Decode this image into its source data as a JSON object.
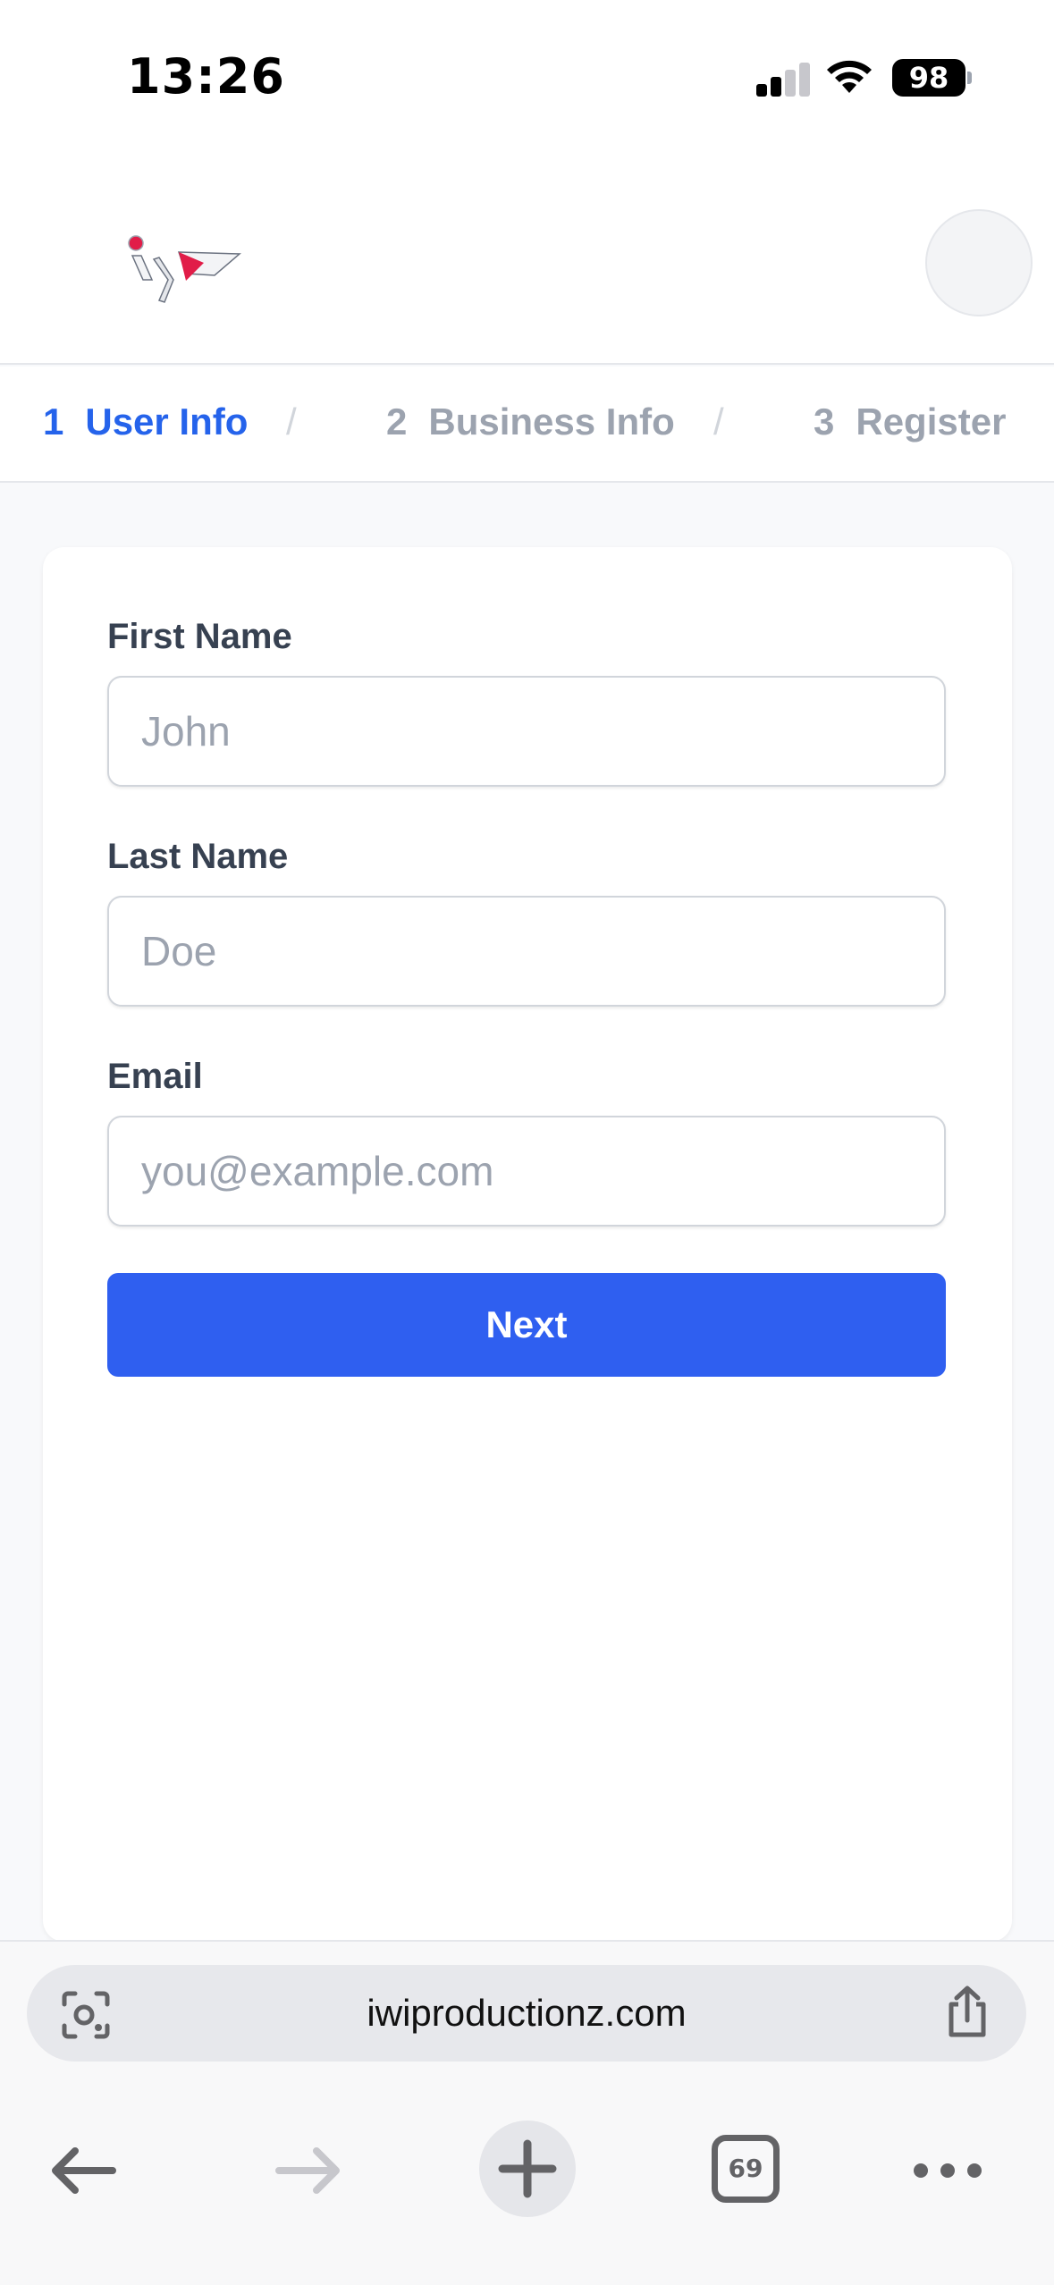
{
  "status_bar": {
    "time": "13:26",
    "battery": "98",
    "icons": [
      "signal-icon",
      "wifi-icon",
      "battery-icon"
    ]
  },
  "header": {
    "logo_icon": "iwp-logo",
    "avatar_icon": "avatar"
  },
  "steps": [
    {
      "number": "1",
      "label": "User Info",
      "active": true
    },
    {
      "number": "2",
      "label": "Business Info",
      "active": false
    },
    {
      "number": "3",
      "label": "Register",
      "active": false
    }
  ],
  "steps_separator": "/",
  "form": {
    "first_name": {
      "label": "First Name",
      "placeholder": "John",
      "value": ""
    },
    "last_name": {
      "label": "Last Name",
      "placeholder": "Doe",
      "value": ""
    },
    "email": {
      "label": "Email",
      "placeholder": "you@example.com",
      "value": ""
    },
    "next_label": "Next"
  },
  "browser": {
    "url": "iwiproductionz.com",
    "tab_count": "69",
    "icons": [
      "lens-icon",
      "share-icon",
      "back-arrow-icon",
      "forward-arrow-icon",
      "plus-icon",
      "tabs-icon",
      "more-icon"
    ]
  },
  "colors": {
    "accent": "#2563eb",
    "button": "#2f5ff0",
    "muted": "#9ca3af",
    "logo_red": "#e11d48"
  }
}
